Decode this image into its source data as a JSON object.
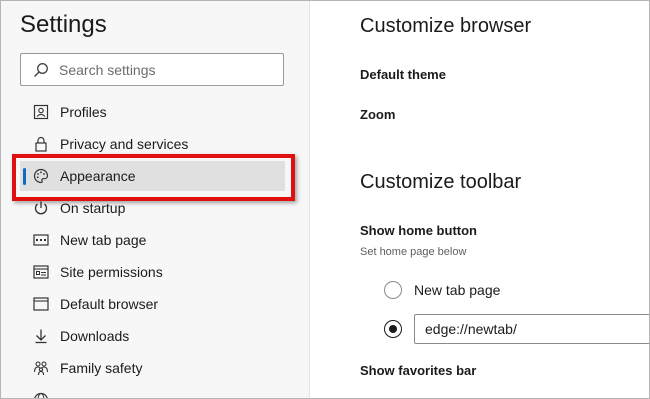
{
  "sidebar": {
    "title": "Settings",
    "search": {
      "placeholder": "Search settings",
      "icon": "search-icon"
    },
    "items": [
      {
        "label": "Profiles",
        "icon": "profile-card-icon"
      },
      {
        "label": "Privacy and services",
        "icon": "lock-icon"
      },
      {
        "label": "Appearance",
        "icon": "palette-icon",
        "active": true
      },
      {
        "label": "On startup",
        "icon": "power-icon"
      },
      {
        "label": "New tab page",
        "icon": "new-tab-page-icon"
      },
      {
        "label": "Site permissions",
        "icon": "site-permissions-icon"
      },
      {
        "label": "Default browser",
        "icon": "browser-window-icon"
      },
      {
        "label": "Downloads",
        "icon": "download-arrow-icon"
      },
      {
        "label": "Family safety",
        "icon": "family-icon"
      }
    ],
    "highlight_color": "#e01010",
    "active_indicator_color": "#0f6cbd"
  },
  "main": {
    "customize_browser": {
      "heading": "Customize browser",
      "default_theme": "Default theme",
      "zoom": "Zoom"
    },
    "customize_toolbar": {
      "heading": "Customize toolbar",
      "show_home_button": "Show home button",
      "home_hint": "Set home page below",
      "options": [
        {
          "label": "New tab page",
          "selected": false
        },
        {
          "value": "edge://newtab/",
          "selected": true
        }
      ],
      "show_favorites_bar": "Show favorites bar"
    }
  }
}
